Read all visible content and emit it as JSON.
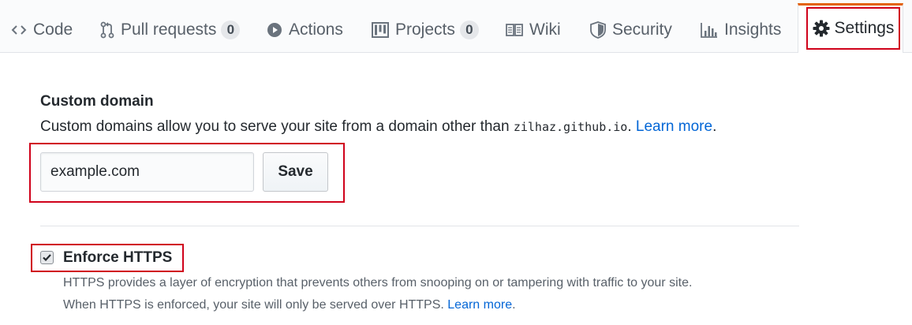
{
  "tabs": {
    "code": {
      "label": "Code",
      "icon": "code-icon"
    },
    "pulls": {
      "label": "Pull requests",
      "count": "0",
      "icon": "pull-request-icon"
    },
    "actions": {
      "label": "Actions",
      "icon": "play-icon"
    },
    "projects": {
      "label": "Projects",
      "count": "0",
      "icon": "project-icon"
    },
    "wiki": {
      "label": "Wiki",
      "icon": "book-icon"
    },
    "security": {
      "label": "Security",
      "icon": "shield-icon"
    },
    "insights": {
      "label": "Insights",
      "icon": "graph-icon"
    },
    "settings": {
      "label": "Settings",
      "icon": "gear-icon",
      "selected": true
    }
  },
  "custom_domain": {
    "title": "Custom domain",
    "description_before": "Custom domains allow you to serve your site from a domain other than ",
    "domain": "zilhaz.github.io",
    "description_after": ". ",
    "learn_more": "Learn more",
    "trailing": ".",
    "input_placeholder": "example.com",
    "save_label": "Save"
  },
  "https": {
    "label": "Enforce HTTPS",
    "checked": true,
    "note_line1": "HTTPS provides a layer of encryption that prevents others from snooping on or tampering with traffic to your site.",
    "note_line2_before": "When HTTPS is enforced, your site will only be served over HTTPS. ",
    "learn_more": "Learn more",
    "trailing": "."
  },
  "colors": {
    "accent_tab": "#e36209",
    "highlight_box": "#d0021b",
    "link": "#0366d6"
  }
}
